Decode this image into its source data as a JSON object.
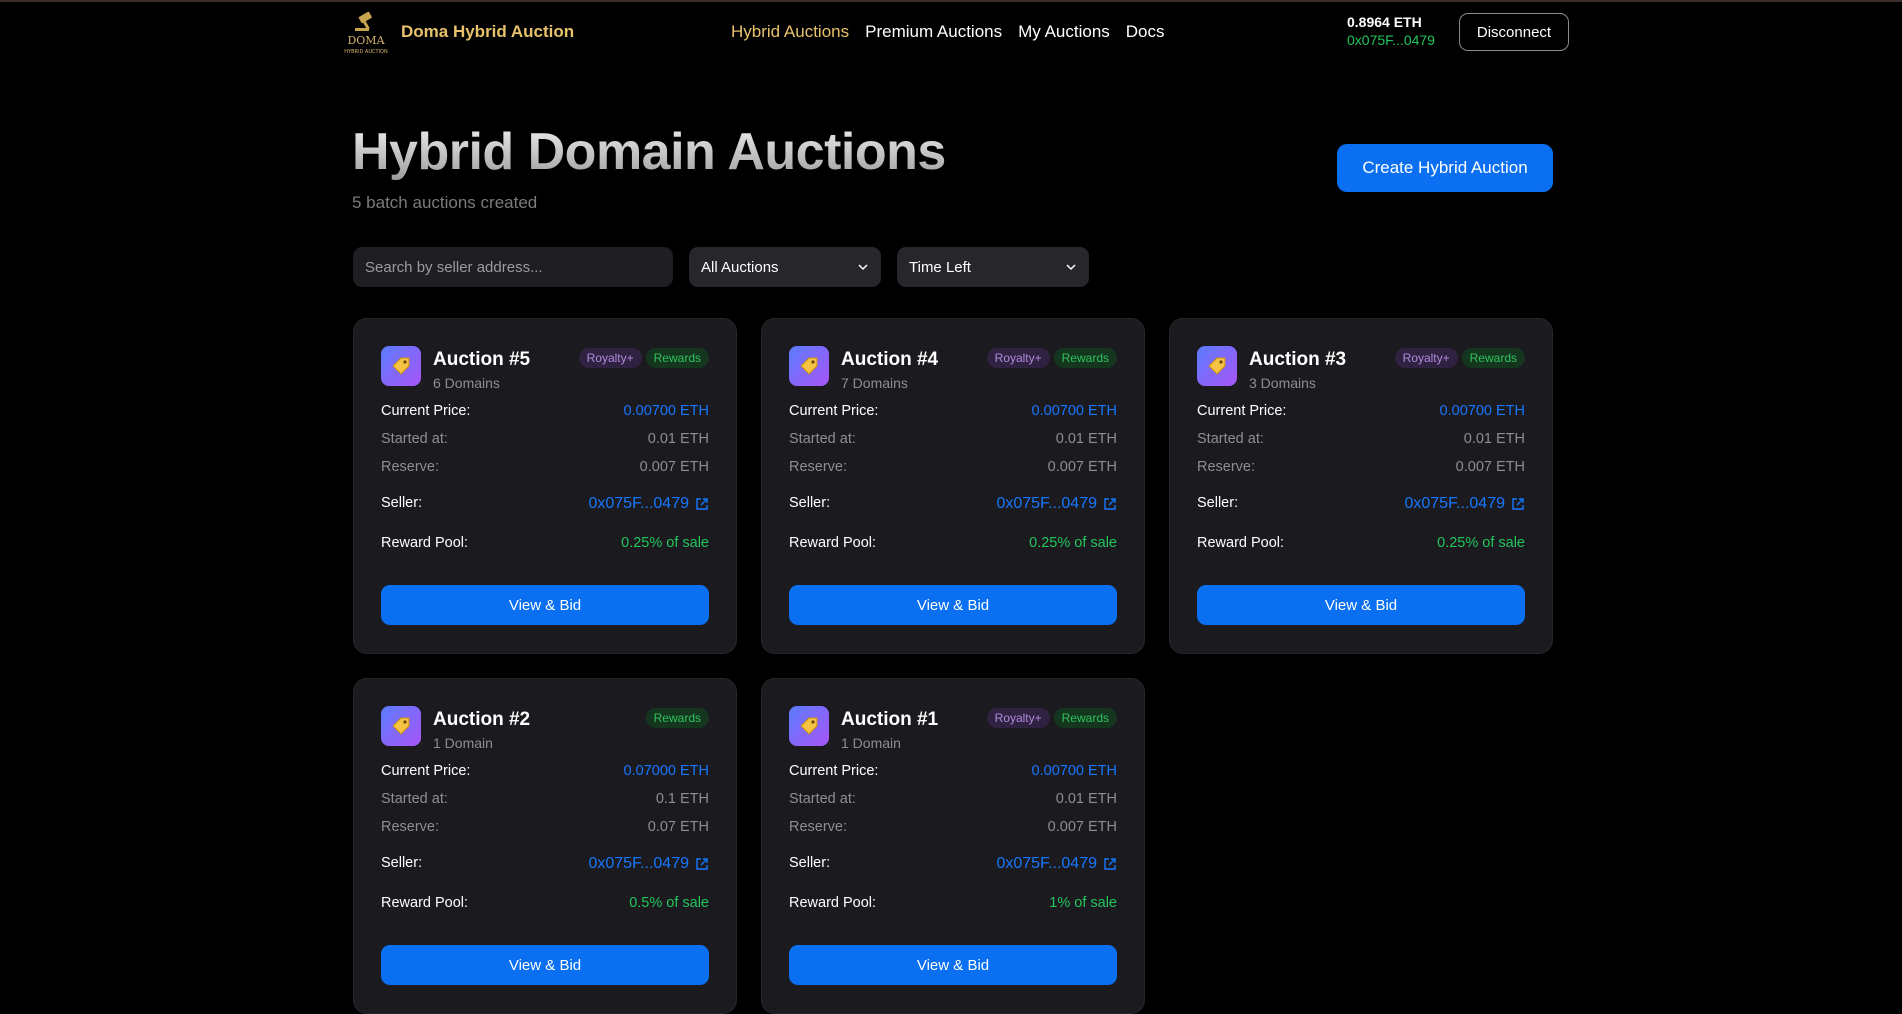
{
  "header": {
    "logo_text": "DOMA",
    "logo_subtext": "HYBRID AUCTION",
    "brand": "Doma Hybrid Auction",
    "nav": [
      "Hybrid Auctions",
      "Premium Auctions",
      "My Auctions",
      "Docs"
    ],
    "active_nav": "Hybrid Auctions",
    "balance": "0.8964 ETH",
    "address": "0x075F...0479",
    "disconnect_label": "Disconnect"
  },
  "page": {
    "title": "Hybrid Domain Auctions",
    "subtitle": "5 batch auctions created",
    "create_label": "Create Hybrid Auction"
  },
  "filters": {
    "search_placeholder": "Search by seller address...",
    "status_value": "All Auctions",
    "sort_value": "Time Left"
  },
  "labels": {
    "current_price": "Current Price:",
    "started_at": "Started at:",
    "reserve": "Reserve:",
    "seller": "Seller:",
    "reward_pool": "Reward Pool:",
    "view_bid": "View & Bid",
    "badge_royalty": "Royalty+",
    "badge_rewards": "Rewards"
  },
  "colors": {
    "accent": "#0a6ff0",
    "gold": "#e7c26a",
    "green": "#22c55e",
    "card_bg": "#1b1b1f"
  },
  "auctions": [
    {
      "title": "Auction #5",
      "domains": "6 Domains",
      "royalty": true,
      "rewards": true,
      "current_price": "0.00700 ETH",
      "started_at": "0.01 ETH",
      "reserve": "0.007 ETH",
      "seller": "0x075F...0479",
      "reward_pool": "0.25% of sale"
    },
    {
      "title": "Auction #4",
      "domains": "7 Domains",
      "royalty": true,
      "rewards": true,
      "current_price": "0.00700 ETH",
      "started_at": "0.01 ETH",
      "reserve": "0.007 ETH",
      "seller": "0x075F...0479",
      "reward_pool": "0.25% of sale"
    },
    {
      "title": "Auction #3",
      "domains": "3 Domains",
      "royalty": true,
      "rewards": true,
      "current_price": "0.00700 ETH",
      "started_at": "0.01 ETH",
      "reserve": "0.007 ETH",
      "seller": "0x075F...0479",
      "reward_pool": "0.25% of sale"
    },
    {
      "title": "Auction #2",
      "domains": "1 Domain",
      "royalty": false,
      "rewards": true,
      "current_price": "0.07000 ETH",
      "started_at": "0.1 ETH",
      "reserve": "0.07 ETH",
      "seller": "0x075F...0479",
      "reward_pool": "0.5% of sale"
    },
    {
      "title": "Auction #1",
      "domains": "1 Domain",
      "royalty": true,
      "rewards": true,
      "current_price": "0.00700 ETH",
      "started_at": "0.01 ETH",
      "reserve": "0.007 ETH",
      "seller": "0x075F...0479",
      "reward_pool": "1% of sale"
    }
  ]
}
